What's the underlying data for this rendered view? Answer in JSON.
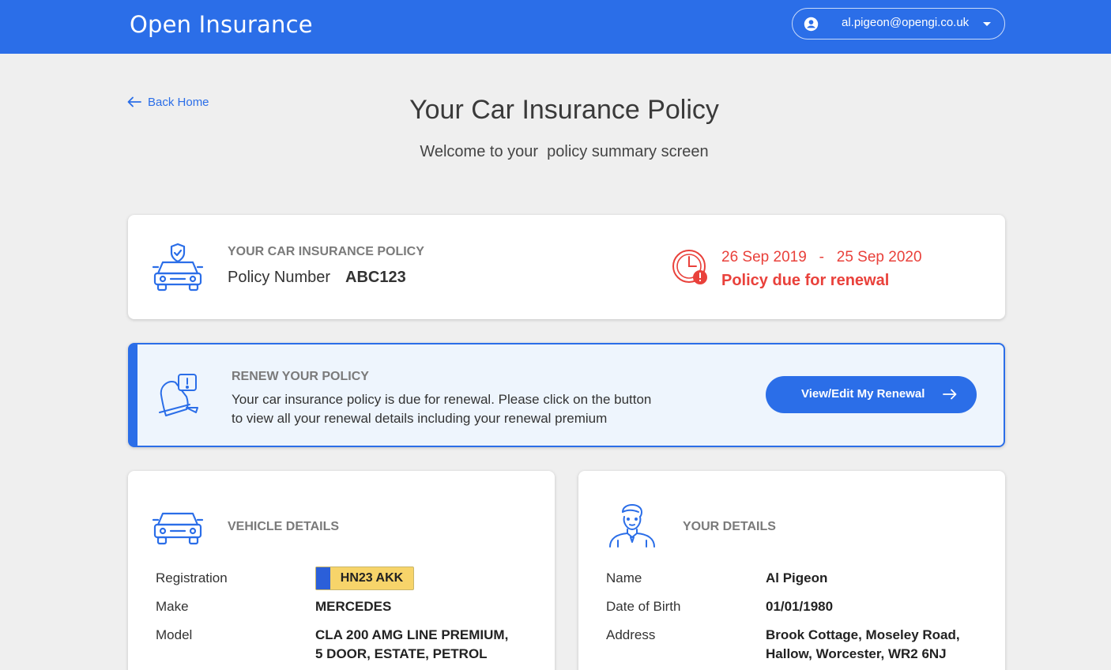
{
  "header": {
    "logo": "Open Insurance",
    "user_email": "al.pigeon@opengi.co.uk",
    "user_icon": "account-circle-icon",
    "caret_icon": "caret-down-icon"
  },
  "page": {
    "back_label": "Back Home",
    "title": "Your Car Insurance Policy",
    "subtitle": "Welcome to your  policy summary screen"
  },
  "policy": {
    "label": "YOUR CAR INSURANCE POLICY",
    "number_label": "Policy Number",
    "number_value": "ABC123",
    "dates": "26 Sep 2019   -   25 Sep 2020",
    "status": "Policy due for renewal"
  },
  "renew": {
    "label": "RENEW YOUR POLICY",
    "message": "Your car insurance policy is due for renewal. Please click on the button\n to view all your renewal details including your renewal premium",
    "button_label": "View/Edit My Renewal"
  },
  "vehicle": {
    "title": "VEHICLE DETAILS",
    "registration_label": "Registration",
    "registration_value": "HN23 AKK",
    "make_label": "Make",
    "make_value": "MERCEDES",
    "model_label": "Model",
    "model_value_line1": "CLA 200 AMG LINE PREMIUM,",
    "model_value_line2": "5 DOOR, ESTATE, PETROL"
  },
  "details": {
    "title": "YOUR DETAILS",
    "name_label": "Name",
    "name_value": "Al Pigeon",
    "dob_label": "Date of Birth",
    "dob_value": "01/01/1980",
    "address_label": "Address",
    "address_line1": "Brook Cottage, Moseley Road,",
    "address_line2": "Hallow, Worcester, WR2 6NJ"
  },
  "colors": {
    "brand": "#2b6ee8",
    "alert": "#e9413b",
    "renew_bg": "#eef5fd",
    "plate_yellow": "#f7d46a"
  }
}
